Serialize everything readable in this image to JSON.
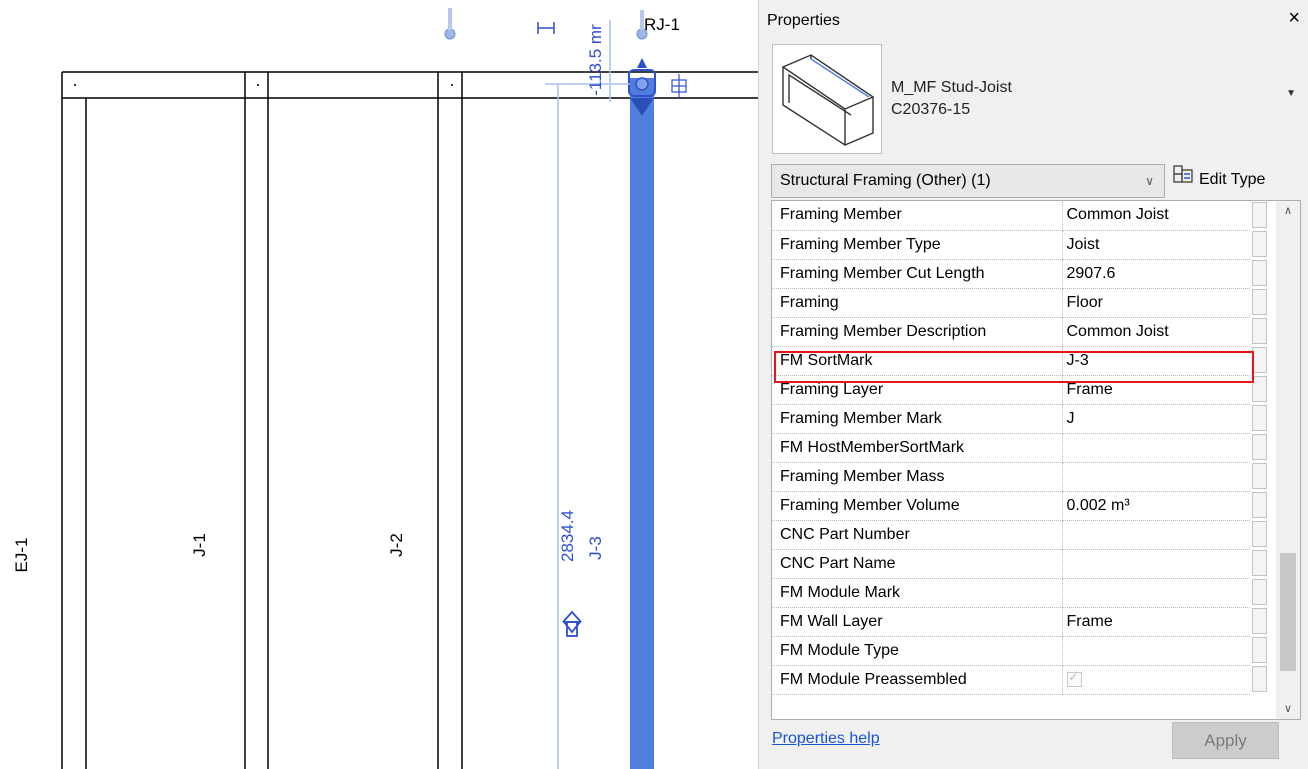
{
  "drawing": {
    "labels": {
      "top_mark": "RJ-1",
      "offset_dim": "-113.5 mr",
      "length_dim": "2834.4",
      "selected_mark": "J-3",
      "joists": [
        "EJ-1",
        "J-1",
        "J-2"
      ]
    }
  },
  "properties": {
    "title": "Properties",
    "close_glyph": "×",
    "type": {
      "line1": "M_MF Stud-Joist",
      "line2": "C20376-15"
    },
    "category_filter": "Structural Framing (Other) (1)",
    "edit_type_label": "Edit Type",
    "rows": [
      {
        "name": "Framing Member",
        "value": "Common Joist"
      },
      {
        "name": "Framing Member Type",
        "value": "Joist"
      },
      {
        "name": "Framing Member Cut Length",
        "value": "2907.6"
      },
      {
        "name": "Framing",
        "value": "Floor"
      },
      {
        "name": "Framing Member Description",
        "value": "Common Joist"
      },
      {
        "name": "FM SortMark",
        "value": "J-3"
      },
      {
        "name": "Framing Layer",
        "value": "Frame"
      },
      {
        "name": "Framing Member Mark",
        "value": "J"
      },
      {
        "name": "FM HostMemberSortMark",
        "value": ""
      },
      {
        "name": "Framing Member Mass",
        "value": ""
      },
      {
        "name": "Framing Member Volume",
        "value": "0.002 m³"
      },
      {
        "name": "CNC Part Number",
        "value": ""
      },
      {
        "name": "CNC Part Name",
        "value": ""
      },
      {
        "name": "FM Module Mark",
        "value": ""
      },
      {
        "name": "FM Wall Layer",
        "value": "Frame"
      },
      {
        "name": "FM Module Type",
        "value": ""
      },
      {
        "name": "FM Module Preassembled",
        "value": "",
        "checkbox": true,
        "checked": true
      }
    ],
    "help_link": "Properties help",
    "apply_label": "Apply",
    "highlight_color": "#e8141c",
    "selection_color": "#4f7fdc"
  }
}
